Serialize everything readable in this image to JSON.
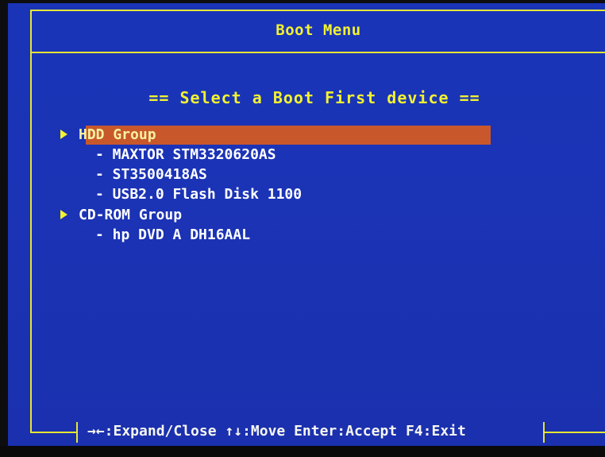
{
  "window": {
    "title": "Boot Menu"
  },
  "prompt": "== Select a Boot First device ==",
  "groups": [
    {
      "label": "HDD Group",
      "selected": true,
      "items": [
        "- MAXTOR STM3320620AS",
        "- ST3500418AS",
        "- USB2.0 Flash Disk 1100"
      ]
    },
    {
      "label": "CD-ROM Group",
      "selected": false,
      "items": [
        "- hp DVD A DH16AAL"
      ]
    }
  ],
  "footer": {
    "help": "→←:Expand/Close ↑↓:Move Enter:Accept F4:Exit"
  },
  "colors": {
    "background": "#1b33b5",
    "frame": "#e6e634",
    "title_text": "#f2f230",
    "highlight": "#c8582c",
    "item_text": "#ffffff"
  }
}
